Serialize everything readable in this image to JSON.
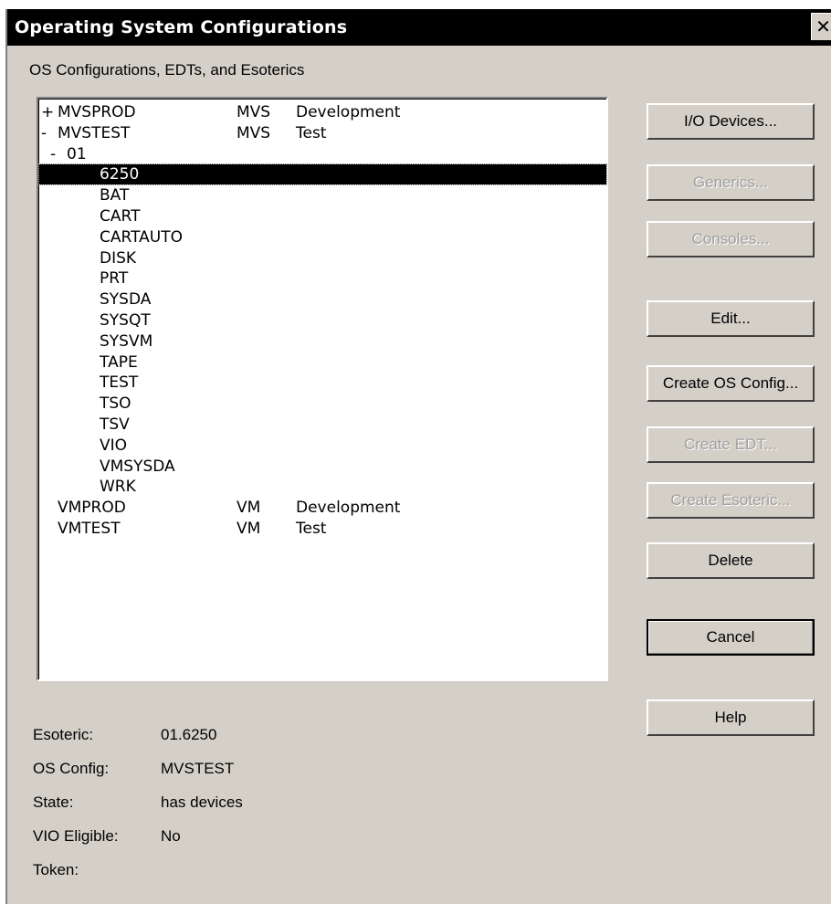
{
  "window": {
    "title": "Operating System Configurations",
    "close_glyph": "✕"
  },
  "section_label": "OS Configurations, EDTs, and Esoterics",
  "tree": {
    "rows": [
      {
        "prefix": "+",
        "name": "MVSPROD",
        "type": "MVS",
        "desc": "Development",
        "level": 0
      },
      {
        "prefix": "-",
        "name": "MVSTEST",
        "type": "MVS",
        "desc": "Test",
        "level": 0
      },
      {
        "prefix": "-",
        "name": "01",
        "type": "",
        "desc": "",
        "level": 1
      },
      {
        "prefix": "",
        "name": "6250",
        "type": "",
        "desc": "",
        "level": 2,
        "selected": true
      },
      {
        "prefix": "",
        "name": "BAT",
        "type": "",
        "desc": "",
        "level": 2
      },
      {
        "prefix": "",
        "name": "CART",
        "type": "",
        "desc": "",
        "level": 2
      },
      {
        "prefix": "",
        "name": "CARTAUTO",
        "type": "",
        "desc": "",
        "level": 2
      },
      {
        "prefix": "",
        "name": "DISK",
        "type": "",
        "desc": "",
        "level": 2
      },
      {
        "prefix": "",
        "name": "PRT",
        "type": "",
        "desc": "",
        "level": 2
      },
      {
        "prefix": "",
        "name": "SYSDA",
        "type": "",
        "desc": "",
        "level": 2
      },
      {
        "prefix": "",
        "name": "SYSQT",
        "type": "",
        "desc": "",
        "level": 2
      },
      {
        "prefix": "",
        "name": "SYSVM",
        "type": "",
        "desc": "",
        "level": 2
      },
      {
        "prefix": "",
        "name": "TAPE",
        "type": "",
        "desc": "",
        "level": 2
      },
      {
        "prefix": "",
        "name": "TEST",
        "type": "",
        "desc": "",
        "level": 2
      },
      {
        "prefix": "",
        "name": "TSO",
        "type": "",
        "desc": "",
        "level": 2
      },
      {
        "prefix": "",
        "name": "TSV",
        "type": "",
        "desc": "",
        "level": 2
      },
      {
        "prefix": "",
        "name": "VIO",
        "type": "",
        "desc": "",
        "level": 2
      },
      {
        "prefix": "",
        "name": "VMSYSDA",
        "type": "",
        "desc": "",
        "level": 2
      },
      {
        "prefix": "",
        "name": "WRK",
        "type": "",
        "desc": "",
        "level": 2
      },
      {
        "prefix": "",
        "name": "VMPROD",
        "type": "VM",
        "desc": "Development",
        "level": 0
      },
      {
        "prefix": "",
        "name": "VMTEST",
        "type": "VM",
        "desc": "Test",
        "level": 0
      }
    ]
  },
  "buttons": [
    {
      "label": "I/O Devices...",
      "enabled": true
    },
    {
      "label": "Generics...",
      "enabled": false
    },
    {
      "label": "Consoles...",
      "enabled": false
    },
    {
      "label": "Edit...",
      "enabled": true
    },
    {
      "label": "Create OS Config...",
      "enabled": true
    },
    {
      "label": "Create EDT...",
      "enabled": false
    },
    {
      "label": "Create Esoteric...",
      "enabled": false
    },
    {
      "label": "Delete",
      "enabled": true
    },
    {
      "label": "Cancel",
      "enabled": true
    },
    {
      "label": "Help",
      "enabled": true
    }
  ],
  "info": {
    "esoteric_label": "Esoteric:",
    "esoteric_value": "01.6250",
    "os_config_label": "OS Config:",
    "os_config_value": "MVSTEST",
    "state_label": "State:",
    "state_value": "has devices",
    "vio_label": "VIO Eligible:",
    "vio_value": "No",
    "token_label": "Token:",
    "token_value": ""
  }
}
